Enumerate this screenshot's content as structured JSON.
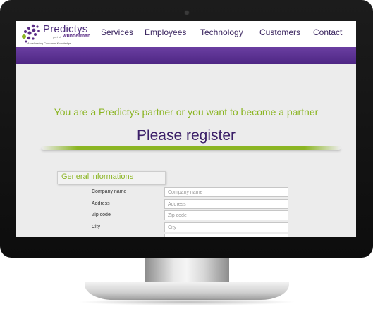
{
  "logo": {
    "name": "Predictys",
    "part_of": "part of",
    "company": "wunderman",
    "tagline": "Accelerating Customer Knowledge"
  },
  "nav": [
    {
      "label": "Services"
    },
    {
      "label": "Employees"
    },
    {
      "label": "Technology"
    },
    {
      "label": "Customers"
    },
    {
      "label": "Contact"
    }
  ],
  "main": {
    "headline": "You are a Predictys partner or you want to become a partner",
    "register_title": "Please register",
    "section_title": "General informations"
  },
  "form": {
    "fields": [
      {
        "label": "Company name",
        "placeholder": "Company name",
        "value": ""
      },
      {
        "label": "Address",
        "placeholder": "Address",
        "value": ""
      },
      {
        "label": "Zip code",
        "placeholder": "Zip code",
        "value": ""
      },
      {
        "label": "City",
        "placeholder": "City",
        "value": ""
      }
    ]
  },
  "colors": {
    "brand_purple": "#4e2784",
    "accent_green": "#8bb523",
    "nav_text": "#3b2660"
  }
}
